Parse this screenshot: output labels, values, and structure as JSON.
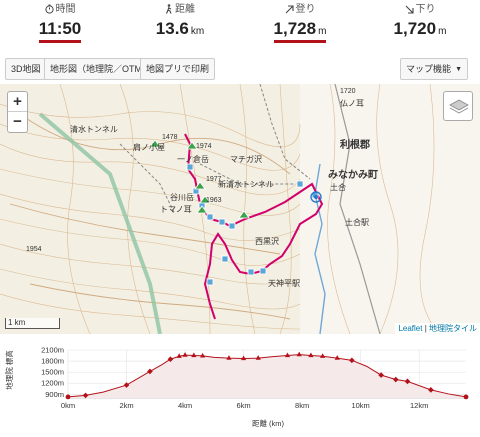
{
  "stats": [
    {
      "label": "時間",
      "value": "11:50",
      "unit": "",
      "icon": "stopwatch-icon",
      "highlight": true
    },
    {
      "label": "距離",
      "value": "13.6",
      "unit": "km",
      "icon": "hiker-icon",
      "highlight": false
    },
    {
      "label": "登り",
      "value": "1,728",
      "unit": "m",
      "icon": "arrow-up-right-icon",
      "highlight": true
    },
    {
      "label": "下り",
      "value": "1,720",
      "unit": "m",
      "icon": "arrow-down-right-icon",
      "highlight": false
    }
  ],
  "toolbar": {
    "btn_3d": "3D地図",
    "btn_gsi": "地形図（地理院／OTM）",
    "btn_print": "地図プリで印刷",
    "btn_features": "マップ機能"
  },
  "map": {
    "zoom_in": "+",
    "zoom_out": "−",
    "scale": "1 km",
    "attribution_link1": "Leaflet",
    "attribution_sep": " | ",
    "attribution_link2": "地理院タイル",
    "labels": {
      "tone_gun": "利根郡",
      "minakami": "みなかみ町",
      "tsuchiai": "土合駅",
      "station_main": "土合",
      "hut": "肩ノ小屋",
      "tanigawa": "谷川岳",
      "tomanomimi": "トマノ耳",
      "ichinokura": "一ノ倉岳",
      "nishikurosawa": "西黒沢",
      "tenjindaira": "天神平駅",
      "hotoke": "仏ノ耳",
      "mayu": "マチガ沢",
      "seiryu": "新清水トンネル",
      "shimizu": "清水トンネル",
      "elev_1954": "1954",
      "elev_1977": "1977",
      "elev_1963": "1963",
      "elev_1720": "1720",
      "elev_1478": "1478",
      "elev_1974": "1974"
    }
  },
  "chart_data": {
    "type": "area",
    "title": "",
    "xlabel": "距離 (km)",
    "ylabel": "地理院 標高",
    "x_ticks": [
      "0km",
      "2km",
      "4km",
      "6km",
      "8km",
      "10km",
      "12km"
    ],
    "y_ticks": [
      "900m",
      "1200m",
      "1500m",
      "1800m",
      "2100m"
    ],
    "xlim": [
      0,
      13.6
    ],
    "ylim": [
      800,
      2100
    ],
    "series": [
      {
        "x": [
          0,
          0.6,
          1.2,
          2.0,
          2.8,
          3.2,
          3.5,
          3.8,
          4.0,
          4.3,
          4.6,
          5.0,
          5.5,
          6.0,
          6.5,
          7.0,
          7.5,
          7.9,
          8.3,
          8.7,
          9.2,
          9.7,
          10.2,
          10.7,
          11.2,
          11.6,
          12.4,
          13.0,
          13.6
        ],
        "y": [
          830,
          870,
          960,
          1150,
          1520,
          1700,
          1850,
          1930,
          1960,
          1950,
          1940,
          1900,
          1880,
          1870,
          1880,
          1920,
          1950,
          1975,
          1950,
          1930,
          1880,
          1820,
          1660,
          1420,
          1300,
          1250,
          1020,
          910,
          830
        ]
      }
    ],
    "markers_x": [
      0,
      0.6,
      2.0,
      2.8,
      3.5,
      3.8,
      4.0,
      4.3,
      4.6,
      5.5,
      6.0,
      6.5,
      7.5,
      7.9,
      8.3,
      8.7,
      9.2,
      9.7,
      10.7,
      11.2,
      11.6,
      12.4,
      13.6
    ],
    "color": "#b3121b"
  }
}
